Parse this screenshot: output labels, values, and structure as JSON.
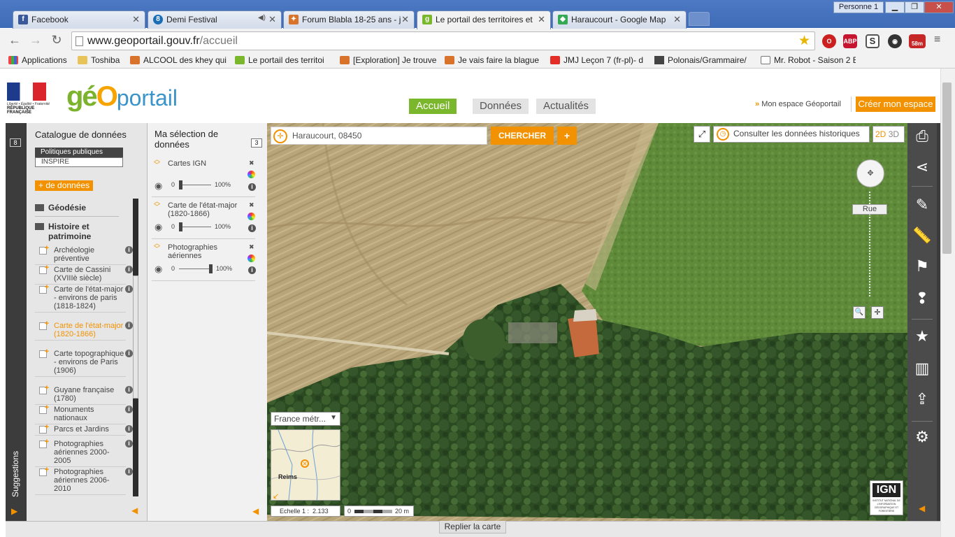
{
  "browser": {
    "tabs": [
      {
        "label": "Facebook",
        "icon": "facebook-icon",
        "color": "#3b5998",
        "glyph": "f"
      },
      {
        "label": "Demi Festival",
        "icon": "sound-icon",
        "color": "#1b6db5",
        "glyph": "8"
      },
      {
        "label": "Forum Blabla 18-25 ans - j",
        "icon": "jvc-icon",
        "color": "#d9732b",
        "glyph": "✦"
      },
      {
        "label": "Le portail des territoires et",
        "icon": "geoportail-icon",
        "color": "#7ab72c",
        "glyph": "g"
      },
      {
        "label": "Haraucourt - Google Map",
        "icon": "maps-icon",
        "color": "#34a853",
        "glyph": "◆"
      }
    ],
    "person": "Personne 1",
    "url_domain": "www.geoportail.gouv.fr",
    "url_path": "/accueil",
    "bookmarks": [
      {
        "label": "Applications",
        "icon": "apps-icon"
      },
      {
        "label": "Toshiba",
        "icon": "folder-icon"
      },
      {
        "label": "ALCOOL des khey qui",
        "icon": "jvc-icon"
      },
      {
        "label": "Le portail des territoi",
        "icon": "geoportail-icon"
      },
      {
        "label": "[Exploration] Je trouve",
        "icon": "jvc-icon"
      },
      {
        "label": "Je vais faire la blague",
        "icon": "jvc-icon"
      },
      {
        "label": "JMJ Leçon 7 (fr-pl)- d",
        "icon": "youtube-icon"
      },
      {
        "label": "Polonais/Grammaire/",
        "icon": "wiki-icon"
      },
      {
        "label": "Mr. Robot - Saison 2 E",
        "icon": "page-icon"
      }
    ],
    "ext_badge": "58m"
  },
  "header": {
    "republic_motto": "Liberté • Égalité • Fraternité",
    "republic_name": "RÉPUBLIQUE FRANÇAISE",
    "logo_geo1": "gé",
    "logo_o": "O",
    "logo_portail": "portail",
    "nav": [
      "Accueil",
      "Données",
      "Actualités"
    ],
    "mon_espace": "Mon espace Géoportail",
    "creer": "Créer mon espace"
  },
  "leftstrip": {
    "count": "8",
    "suggestions": "Suggestions"
  },
  "catalog": {
    "title": "Catalogue de données",
    "tabs": [
      "Politiques publiques",
      "INSPIRE"
    ],
    "more": "+ de données",
    "groups": [
      "Géodésie",
      "Histoire et patrimoine"
    ],
    "items": [
      "Archéologie préventive",
      "Carte de Cassini (XVIIIè siècle)",
      "Carte de l'état-major - environs de paris (1818-1824)",
      "Carte de l'état-major (1820-1866)",
      "Carte topographique - environs de Paris (1906)",
      "Guyane française (1780)",
      "Monuments nationaux",
      "Parcs et Jardins",
      "Photographies aériennes 2000-2005",
      "Photographies aériennes 2006-2010"
    ]
  },
  "selection": {
    "title": "Ma sélection de données",
    "count": "3",
    "layers": [
      {
        "name": "Cartes IGN",
        "opacity_min": "0",
        "opacity_label": "100%",
        "opacity": 0.0
      },
      {
        "name": "Carte de l'état-major (1820-1866)",
        "opacity_min": "0",
        "opacity_label": "100%",
        "opacity": 0.0
      },
      {
        "name": "Photographies aériennes",
        "opacity_min": "0",
        "opacity_label": "100%",
        "opacity": 1.0
      }
    ]
  },
  "map": {
    "search_value": "Haraucourt, 08450",
    "search_button": "CHERCHER",
    "plus": "+",
    "historic": "Consulter les données historiques",
    "view_2d": "2D",
    "view_3d": "3D",
    "zoom_label": "Rue",
    "minimap_select": "France métr...",
    "minimap_city": "Reims",
    "scale_label": "Echelle 1 :",
    "scale_value": "2.133",
    "scalebar_min": "0",
    "scalebar_max": "20 m",
    "ign_label": "IGN",
    "ign_sub": "INSTITUT NATIONAL DE L'INFORMATION GÉOGRAPHIQUE ET FORESTIÈRE"
  },
  "footer": {
    "replier": "Replier la carte"
  },
  "colors": {
    "orange": "#f39200",
    "green": "#7ab72c",
    "dark": "#3c3c3c"
  }
}
